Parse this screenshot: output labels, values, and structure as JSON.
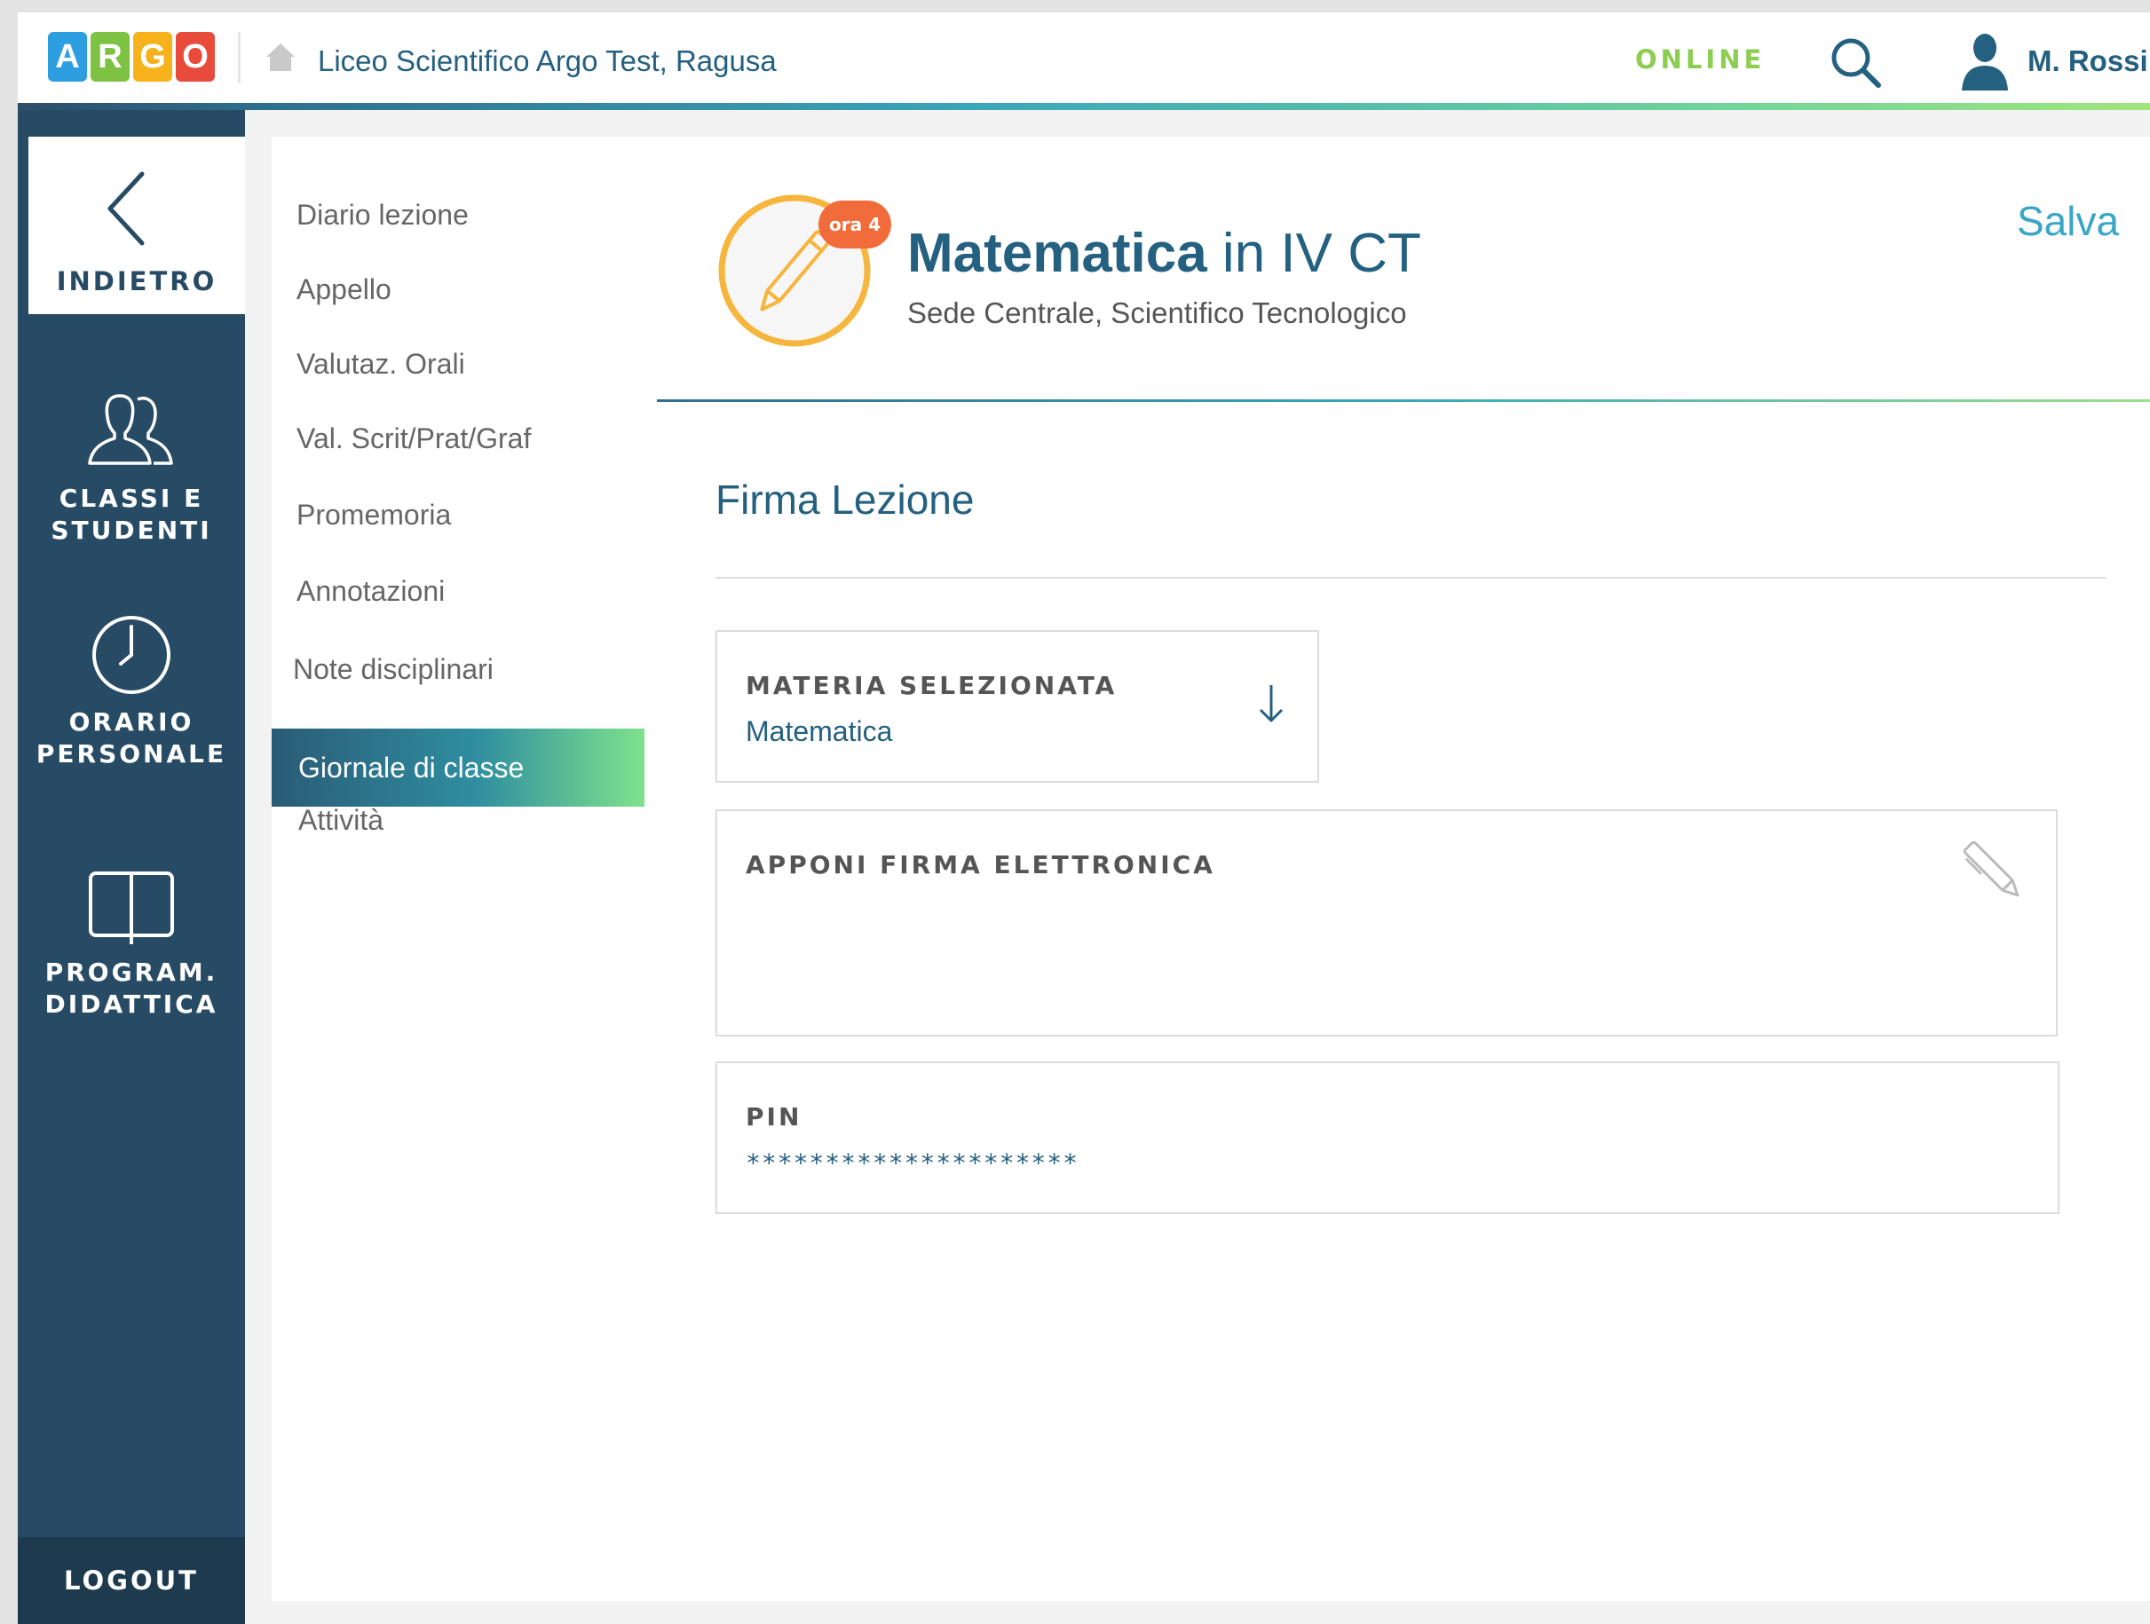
{
  "header": {
    "logo_letters": [
      "A",
      "R",
      "G",
      "O"
    ],
    "logo_colors": [
      "#2d9ee0",
      "#7dc243",
      "#f7b21b",
      "#e84b3c"
    ],
    "school_name": "Liceo Scientifico Argo Test, Ragusa",
    "status": "ONLINE",
    "user_name": "M. Rossi"
  },
  "left_nav": {
    "back_label": "INDIETRO",
    "items": [
      {
        "label_line1": "CLASSI E",
        "label_line2": "STUDENTI",
        "icon": "students-icon"
      },
      {
        "label_line1": "ORARIO",
        "label_line2": "PERSONALE",
        "icon": "clock-icon"
      },
      {
        "label_line1": "PROGRAM.",
        "label_line2": "DIDATTICA",
        "icon": "book-icon"
      }
    ],
    "logout_label": "LOGOUT"
  },
  "submenu": {
    "items": [
      {
        "label": "Diario lezione"
      },
      {
        "label": "Appello"
      },
      {
        "label": "Valutaz. Orali"
      },
      {
        "label": "Val. Scrit/Prat/Graf"
      },
      {
        "label": "Promemoria"
      },
      {
        "label": "Annotazioni"
      },
      {
        "label": "Note disciplinari"
      },
      {
        "label": "Giornale di classe"
      },
      {
        "label": "Attività"
      }
    ],
    "active_label": "Giornale di classe"
  },
  "main": {
    "ora_badge": "ora 4",
    "subject": "Matematica",
    "class_text": " in IV CT",
    "subtitle": "Sede Centrale, Scientifico Tecnologico",
    "save_label": "Salva",
    "section_title": "Firma Lezione",
    "materia_label": "MATERIA SELEZIONATA",
    "materia_value": "Matematica",
    "firma_label": "APPONI FIRMA ELETTRONICA",
    "pin_label": "PIN",
    "pin_value": "*********************"
  },
  "colors": {
    "nav_bg": "#284b65",
    "accent_blue": "#24607f",
    "online_green": "#8ccd52",
    "badge_orange": "#f26b3a",
    "icon_ring": "#f6b53c"
  }
}
